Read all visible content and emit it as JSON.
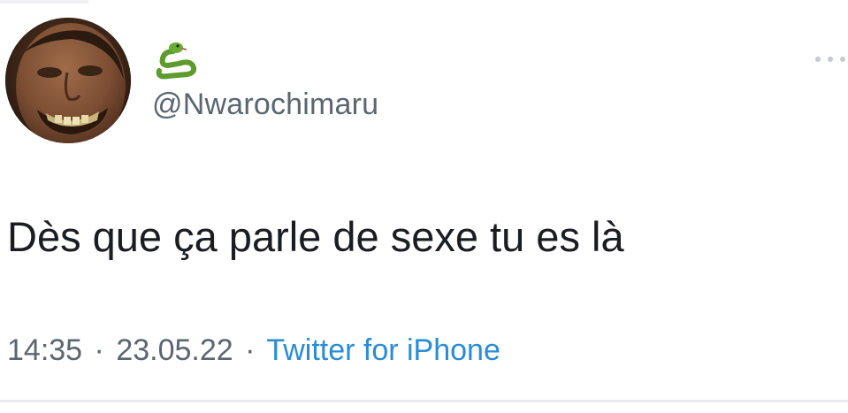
{
  "tweet": {
    "handle": "@Nwarochimaru",
    "display_name_icon": "snake-icon",
    "text": "Dès que ça parle de sexe tu es là",
    "time": "14:35",
    "separator": "·",
    "date": "23.05.22",
    "source": "Twitter for iPhone",
    "avatar_icon": "profile-avatar-icon",
    "more_icon": "more-options-icon"
  },
  "colors": {
    "background": "#ffffff",
    "text": "#14171a",
    "secondary_text": "#5b6670",
    "link": "#2a8bd6",
    "snake_green": "#5e9b2e"
  }
}
